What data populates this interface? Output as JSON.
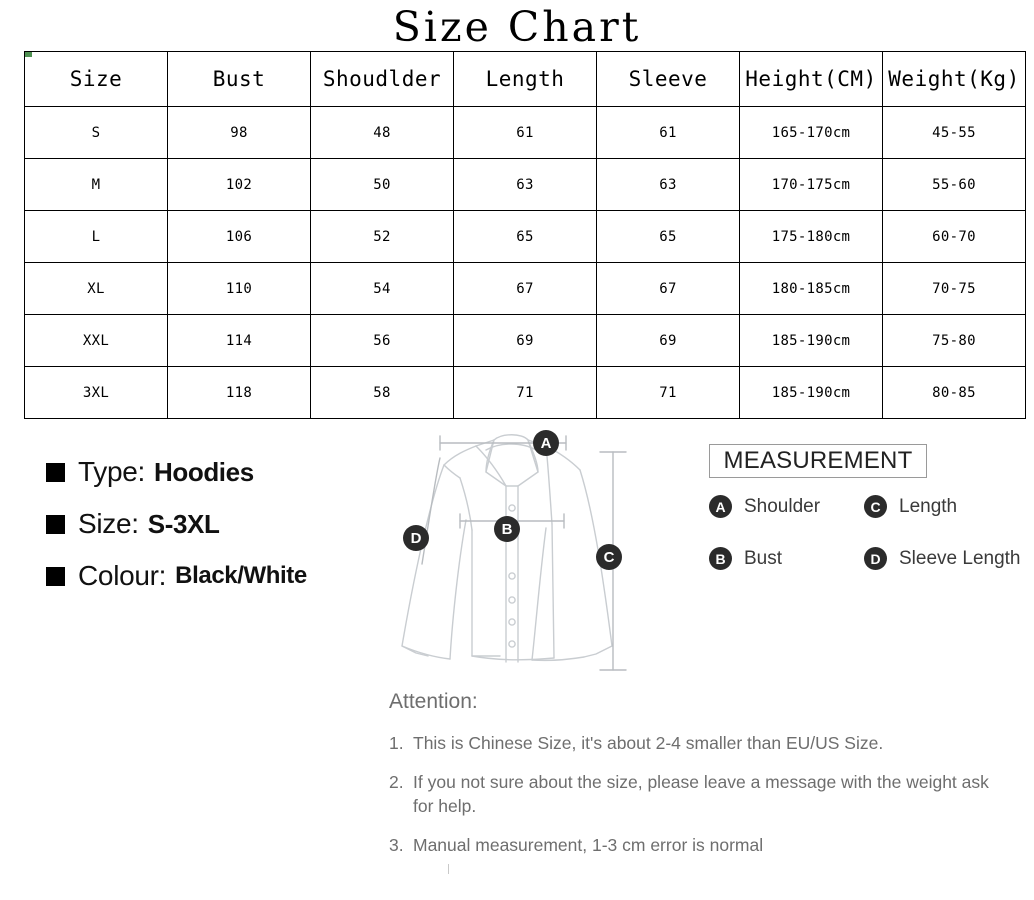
{
  "title": "Size Chart",
  "table": {
    "headers": [
      "Size",
      "Bust",
      "Shoudlder",
      "Length",
      "Sleeve",
      "Height(CM)",
      "Weight(Kg)"
    ],
    "rows": [
      [
        "S",
        "98",
        "48",
        "61",
        "61",
        "165-170cm",
        "45-55"
      ],
      [
        "M",
        "102",
        "50",
        "63",
        "63",
        "170-175cm",
        "55-60"
      ],
      [
        "L",
        "106",
        "52",
        "65",
        "65",
        "175-180cm",
        "60-70"
      ],
      [
        "XL",
        "110",
        "54",
        "67",
        "67",
        "180-185cm",
        "70-75"
      ],
      [
        "XXL",
        "114",
        "56",
        "69",
        "69",
        "185-190cm",
        "75-80"
      ],
      [
        "3XL",
        "118",
        "58",
        "71",
        "71",
        "185-190cm",
        "80-85"
      ]
    ]
  },
  "product_info": [
    {
      "label": "Type:",
      "value": "Hoodies"
    },
    {
      "label": "Size:",
      "value": "S-3XL"
    },
    {
      "label": "Colour:",
      "value": "Black/White"
    }
  ],
  "diagram": {
    "markers": [
      {
        "id": "A",
        "letter": "A",
        "meaning": "Shoulder"
      },
      {
        "id": "B",
        "letter": "B",
        "meaning": "Bust"
      },
      {
        "id": "C",
        "letter": "C",
        "meaning": "Length"
      },
      {
        "id": "D",
        "letter": "D",
        "meaning": "Sleeve Length"
      }
    ]
  },
  "measurement": {
    "title": "MEASUREMENT",
    "items": [
      {
        "letter": "A",
        "label": "Shoulder"
      },
      {
        "letter": "C",
        "label": "Length"
      },
      {
        "letter": "B",
        "label": "Bust"
      },
      {
        "letter": "D",
        "label": "Sleeve Length"
      }
    ]
  },
  "attention": {
    "heading": "Attention:",
    "items": [
      {
        "num": "1.",
        "text": "This is Chinese Size, it's about 2-4 smaller than EU/US Size."
      },
      {
        "num": "2.",
        "text": "If you not sure about the size, please leave a message with the weight ask for help."
      },
      {
        "num": "3.",
        "text": "Manual measurement, 1-3 cm error is normal"
      }
    ]
  },
  "colors": {
    "marker_fill": "#2b2b2b",
    "line_art": "#c9cdd1",
    "bullet": "#000000",
    "attention_text": "#6e6e6e"
  }
}
